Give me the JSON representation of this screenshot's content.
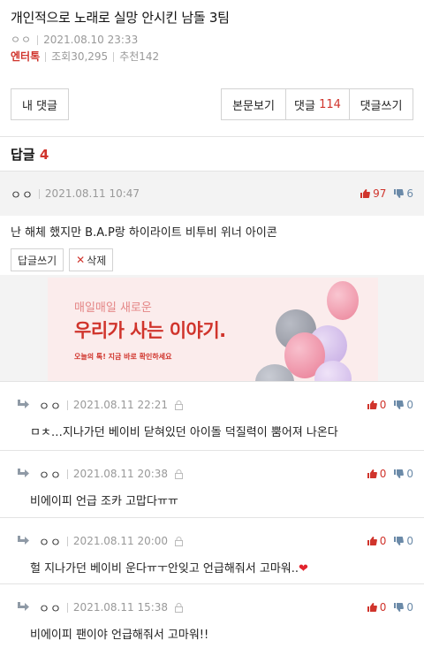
{
  "post": {
    "title": "개인적으로 노래로 실망 안시킨 남돌 3팀",
    "author": "ㅇㅇ",
    "date": "2021.08.10 23:33",
    "category": "엔터톡",
    "views": "조회30,295",
    "recommend": "추천142"
  },
  "buttons": {
    "my_comments": "내 댓글",
    "view_body": "본문보기",
    "comments_label": "댓글",
    "comments_count": "114",
    "write_comment": "댓글쓰기"
  },
  "replies_header": {
    "label": "답글",
    "count": "4"
  },
  "main_comment": {
    "nick": "ㅇㅇ",
    "date": "2021.08.11 10:47",
    "up": "97",
    "down": "6",
    "text": "난 해체 했지만 B.A.P랑 하이라이트 비투비 위너 아이콘",
    "reply_button": "답글쓰기",
    "delete_button": "삭제"
  },
  "ad": {
    "line1": "매일매일 새로운",
    "line2": "우리가 사는 이야기.",
    "line3": "오늘의 톡! 지금 바로 확인하세요"
  },
  "replies": [
    {
      "nick": "ㅇㅇ",
      "date": "2021.08.11 22:21",
      "up": "0",
      "down": "0",
      "text": "ㅁㅊ…지나가던 베이비 닫혀있던 아이돌 덕질력이 뿜어져 나온다"
    },
    {
      "nick": "ㅇㅇ",
      "date": "2021.08.11 20:38",
      "up": "0",
      "down": "0",
      "text": "비에이피 언급 조카 고맙다ㅠㅠ"
    },
    {
      "nick": "ㅇㅇ",
      "date": "2021.08.11 20:00",
      "up": "0",
      "down": "0",
      "text": "헐 지나가던 베이비 운다ㅠㅜ안잊고 언급해줘서 고마워..",
      "emoji": "❤"
    },
    {
      "nick": "ㅇㅇ",
      "date": "2021.08.11 15:38",
      "up": "0",
      "down": "0",
      "text": "비에이피 팬이야 언급해줘서 고마워!!"
    }
  ],
  "icons": {
    "thumb_up": "thumbs-up-icon",
    "thumb_down": "thumbs-down-icon",
    "reply_arrow": "reply-arrow-icon",
    "lock": "lock-icon"
  },
  "colors": {
    "accent": "#d0342c",
    "down": "#6b8aa8",
    "muted": "#999999",
    "header_bg": "#f3f3f3"
  }
}
